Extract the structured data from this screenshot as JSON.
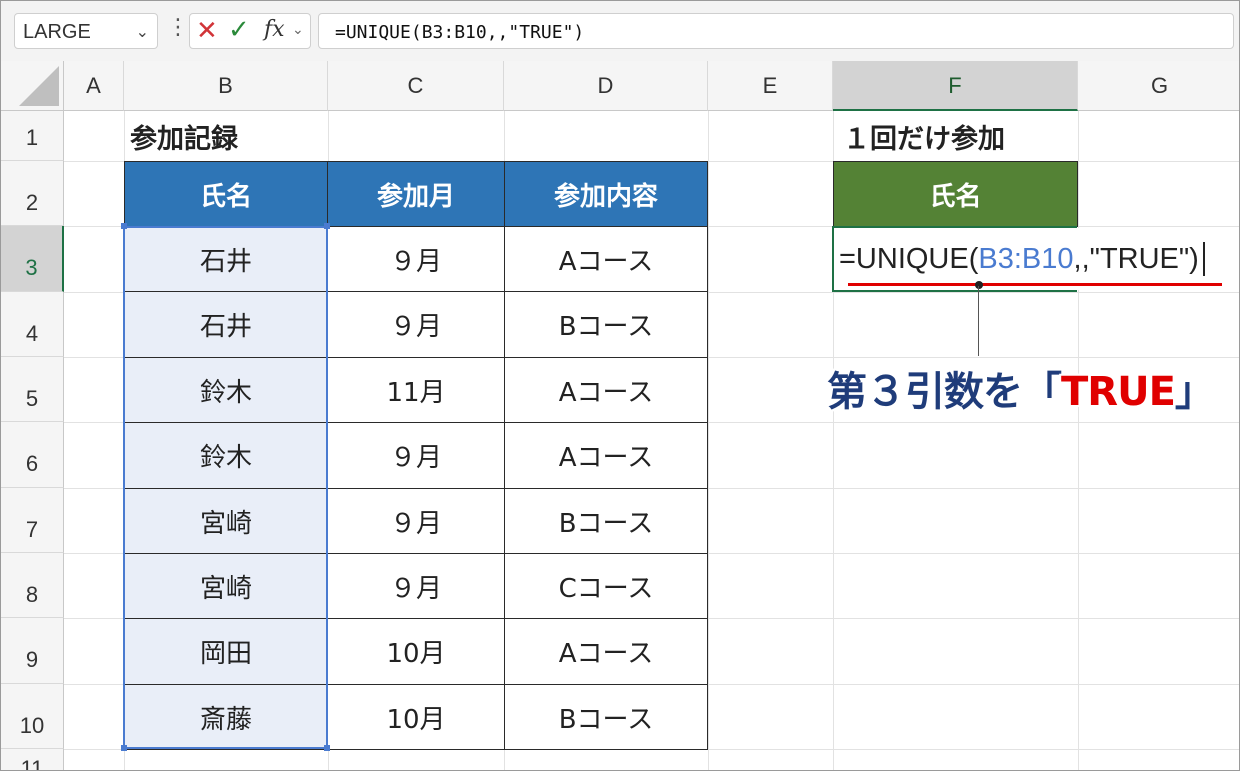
{
  "formula_bar": {
    "name_box": "LARGE",
    "formula": "=UNIQUE(B3:B10,,\"TRUE\")"
  },
  "columns": [
    "A",
    "B",
    "C",
    "D",
    "E",
    "F",
    "G"
  ],
  "rows": [
    "1",
    "2",
    "3",
    "4",
    "5",
    "6",
    "7",
    "8",
    "9",
    "10",
    "11"
  ],
  "sheet": {
    "title": "参加記録",
    "headers": [
      "氏名",
      "参加月",
      "参加内容"
    ],
    "records": [
      [
        "石井",
        "９月",
        "Aコース"
      ],
      [
        "石井",
        "９月",
        "Bコース"
      ],
      [
        "鈴木",
        "11月",
        "Aコース"
      ],
      [
        "鈴木",
        "９月",
        "Aコース"
      ],
      [
        "宮崎",
        "９月",
        "Bコース"
      ],
      [
        "宮崎",
        "９月",
        "Cコース"
      ],
      [
        "岡田",
        "10月",
        "Aコース"
      ],
      [
        "斎藤",
        "10月",
        "Bコース"
      ]
    ],
    "f_title": "１回だけ参加",
    "f_header": "氏名"
  },
  "edit": {
    "prefix": "=UNIQUE(",
    "ref": "B3:B10",
    "suffix": ",,\"TRUE\")"
  },
  "callout": {
    "prefix": "第３引数を「",
    "highlight": "TRUE",
    "suffix": "」"
  },
  "colors": {
    "table_header": "#2e75b6",
    "f_header": "#548235",
    "selection": "#4a7bd0",
    "callout_text": "#1f3c7a",
    "callout_highlight": "#e00000"
  }
}
